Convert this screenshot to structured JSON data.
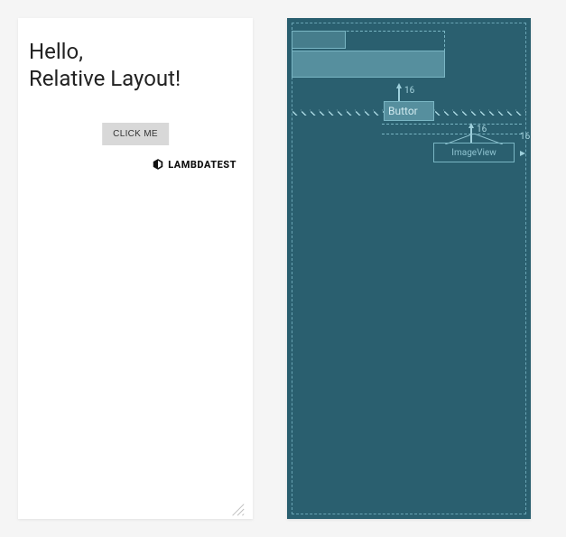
{
  "preview": {
    "title_line1": "Hello,",
    "title_line2": "Relative Layout!",
    "button_label": "CLICK ME",
    "brand_text": "LAMBDATEST"
  },
  "blueprint": {
    "button_label": "Buttor",
    "imageview_label": "ImageView",
    "margin_button_top": "16",
    "margin_image_top": "16",
    "margin_image_end": "16"
  }
}
